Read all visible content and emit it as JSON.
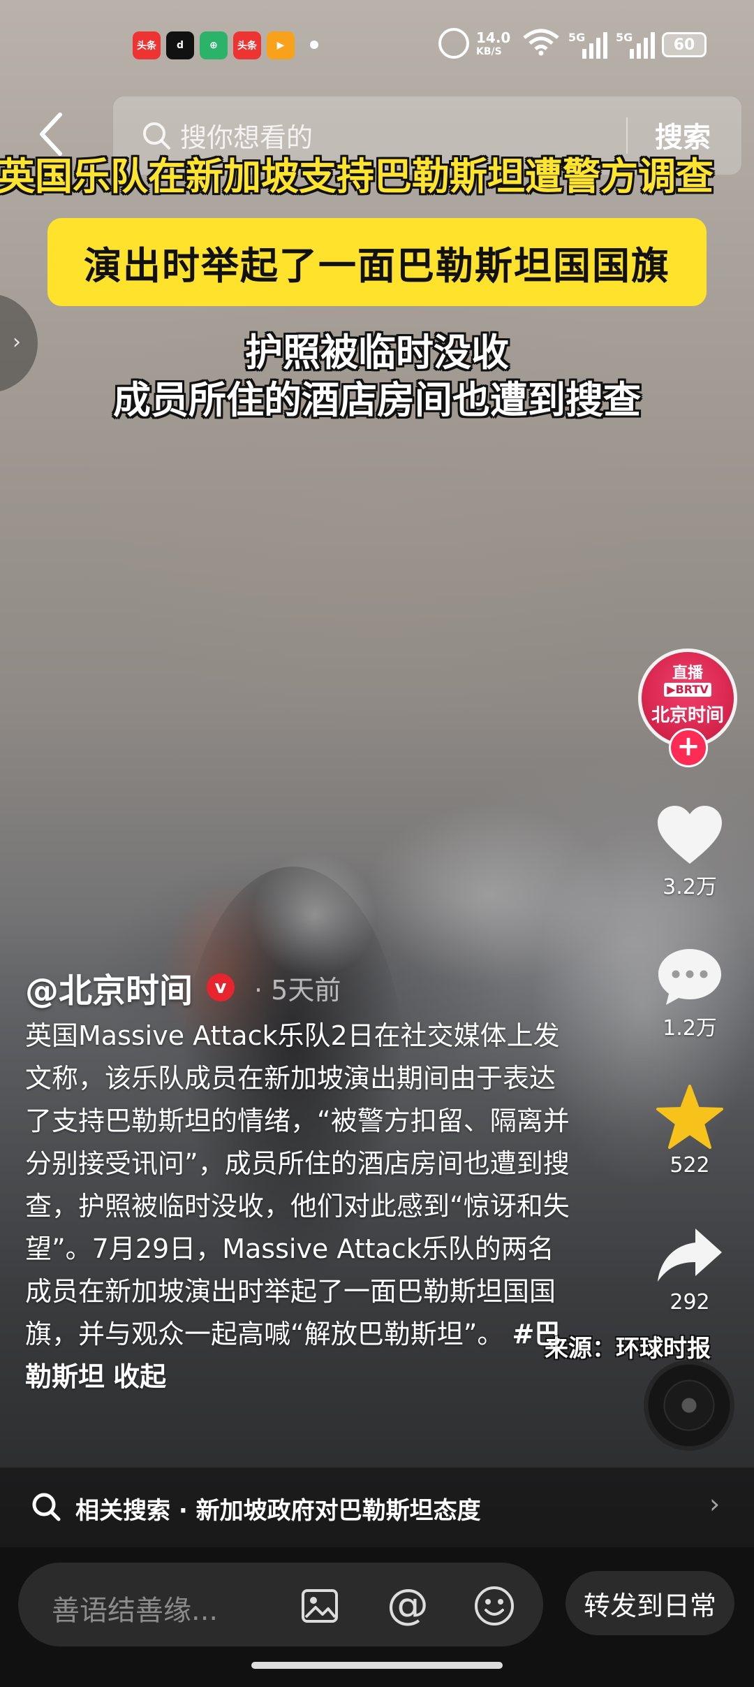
{
  "status_bar": {
    "app_icons": [
      "头条",
      "d",
      "⊕",
      "头条",
      "▶"
    ],
    "net_speed_value": "14.0",
    "net_speed_unit": "KB/S",
    "signal1_tag": "5G",
    "signal2_tag": "5G",
    "battery": "60"
  },
  "search": {
    "placeholder": "搜你想看的",
    "button_label": "搜索"
  },
  "video": {
    "headline": "英国乐队在新加坡支持巴勒斯坦遭警方调查",
    "yellow_caption": "演出时举起了一面巴勒斯坦国国旗",
    "caption_line1": "护照被临时没收",
    "caption_line2": "成员所住的酒店房间也遭到搜查"
  },
  "actions": {
    "avatar_live": "直播",
    "avatar_brtv": "▶BRTV",
    "avatar_name": "北京时间",
    "follow": "+",
    "likes": "3.2万",
    "comments": "1.2万",
    "favorites": "522",
    "shares": "292",
    "source": "来源：环球时报"
  },
  "post": {
    "author": "@北京时间",
    "verified": "v",
    "time": "· 5天前",
    "description": "英国Massive Attack乐队2日在社交媒体上发文称，该乐队成员在新加坡演出期间由于表达了支持巴勒斯坦的情绪，“被警方扣留、隔离并分别接受讯问”，成员所住的酒店房间也遭到搜查，护照被临时没收，他们对此感到“惊讶和失望”。7月29日，Massive Attack乐队的两名成员在新加坡演出时举起了一面巴勒斯坦国国旗，并与观众一起高喊“解放巴勒斯坦”。",
    "hashtag": "#巴勒斯坦",
    "collapse": "收起"
  },
  "related_search": {
    "text": "相关搜索 · 新加坡政府对巴勒斯坦态度"
  },
  "bottom_bar": {
    "comment_placeholder": "善语结善缘...",
    "forward_label": "转发到日常"
  },
  "colors": {
    "headline_yellow": "#ffe52e",
    "caption_box_yellow": "#ffe22c",
    "follow_red": "#fe2c55",
    "favorite_gold": "#f7c21a"
  }
}
